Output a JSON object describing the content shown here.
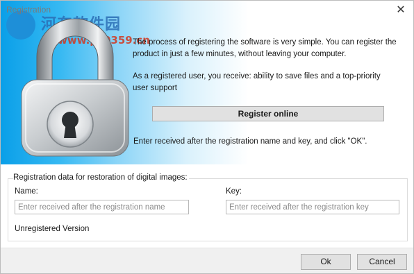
{
  "window": {
    "title": "Registration",
    "close_icon": "close-icon"
  },
  "watermark": {
    "text": "河东软件园",
    "url": "www.pc0359.cn"
  },
  "intro": {
    "line1": "The process of registering the software is very simple. You can register the product in just a few minutes, without leaving your computer.",
    "line2": "As a registered user, you receive: ability to save files and a top-priority user support"
  },
  "register_button": "Register online",
  "hint": "Enter received after the registration name and key, and click \"OK\".",
  "registration": {
    "group_title": "Registration data for restoration of digital images:",
    "name_label": "Name:",
    "name_placeholder": "Enter received after the registration name",
    "key_label": "Key:",
    "key_placeholder": "Enter received after the registration key",
    "status": "Unregistered Version"
  },
  "footer": {
    "ok_label": "Ok",
    "cancel_label": "Cancel"
  },
  "colors": {
    "banner_blue": "#0a9fe8",
    "button_face": "#e1e1e1",
    "footer_bg": "#f0f0f0"
  }
}
